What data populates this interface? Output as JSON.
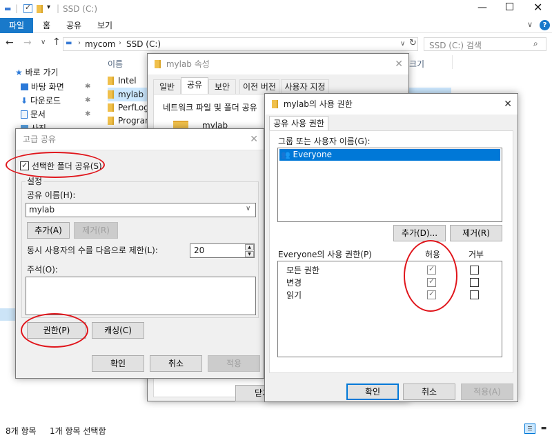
{
  "explorer": {
    "title": "SSD (C:)",
    "ribbon_tabs": [
      "파일",
      "홈",
      "공유",
      "보기"
    ],
    "breadcrumb": [
      "mycom",
      "SSD (C:)"
    ],
    "search_placeholder": "SSD (C:) 검색",
    "column_name": "이름",
    "column_size_partial": "크기",
    "nav": {
      "quick_access": "바로 가기",
      "items": [
        "바탕 화면",
        "다운로드",
        "문서",
        "사진"
      ]
    },
    "files": [
      "Intel",
      "mylab",
      "PerfLogs",
      "Program"
    ],
    "status": {
      "item_count": "8개 항목",
      "selected": "1개 항목 선택함"
    }
  },
  "properties_dialog": {
    "title": "mylab 속성",
    "tabs": [
      "일반",
      "공유",
      "보안",
      "이전 버전",
      "사용자 지정"
    ],
    "section": "네트워크 파일 및 폴더 공유",
    "folder_name": "mylab",
    "close_partial": "닫기"
  },
  "advanced_sharing": {
    "title": "고급 공유",
    "share_checkbox_label": "선택한 폴더 공유(S)",
    "share_checked": true,
    "settings_group": "설정",
    "share_name_label": "공유 이름(H):",
    "share_name_value": "mylab",
    "add_button": "추가(A)",
    "remove_button": "제거(R)",
    "limit_label": "동시 사용자의 수를 다음으로 제한(L):",
    "limit_value": "20",
    "comment_label": "주석(O):",
    "permissions_button": "권한(P)",
    "caching_button": "캐싱(C)",
    "ok_button": "확인",
    "cancel_button": "취소",
    "apply_button": "적용"
  },
  "permissions_dialog": {
    "title": "mylab의 사용 권한",
    "tab": "공유 사용 권한",
    "group_label": "그룹 또는 사용자 이름(G):",
    "users": [
      "Everyone"
    ],
    "add_button": "추가(D)...",
    "remove_button": "제거(R)",
    "perm_label": "Everyone의 사용 권한(P)",
    "allow_header": "허용",
    "deny_header": "거부",
    "permissions": [
      {
        "name": "모든 권한",
        "allow": true,
        "deny": false
      },
      {
        "name": "변경",
        "allow": true,
        "deny": false
      },
      {
        "name": "읽기",
        "allow": true,
        "deny": false
      }
    ],
    "ok_button": "확인",
    "cancel_button": "취소",
    "apply_button": "적용(A)"
  },
  "colors": {
    "accent": "#1979ca",
    "selection": "#0078d7",
    "annotation": "#e0161c"
  }
}
